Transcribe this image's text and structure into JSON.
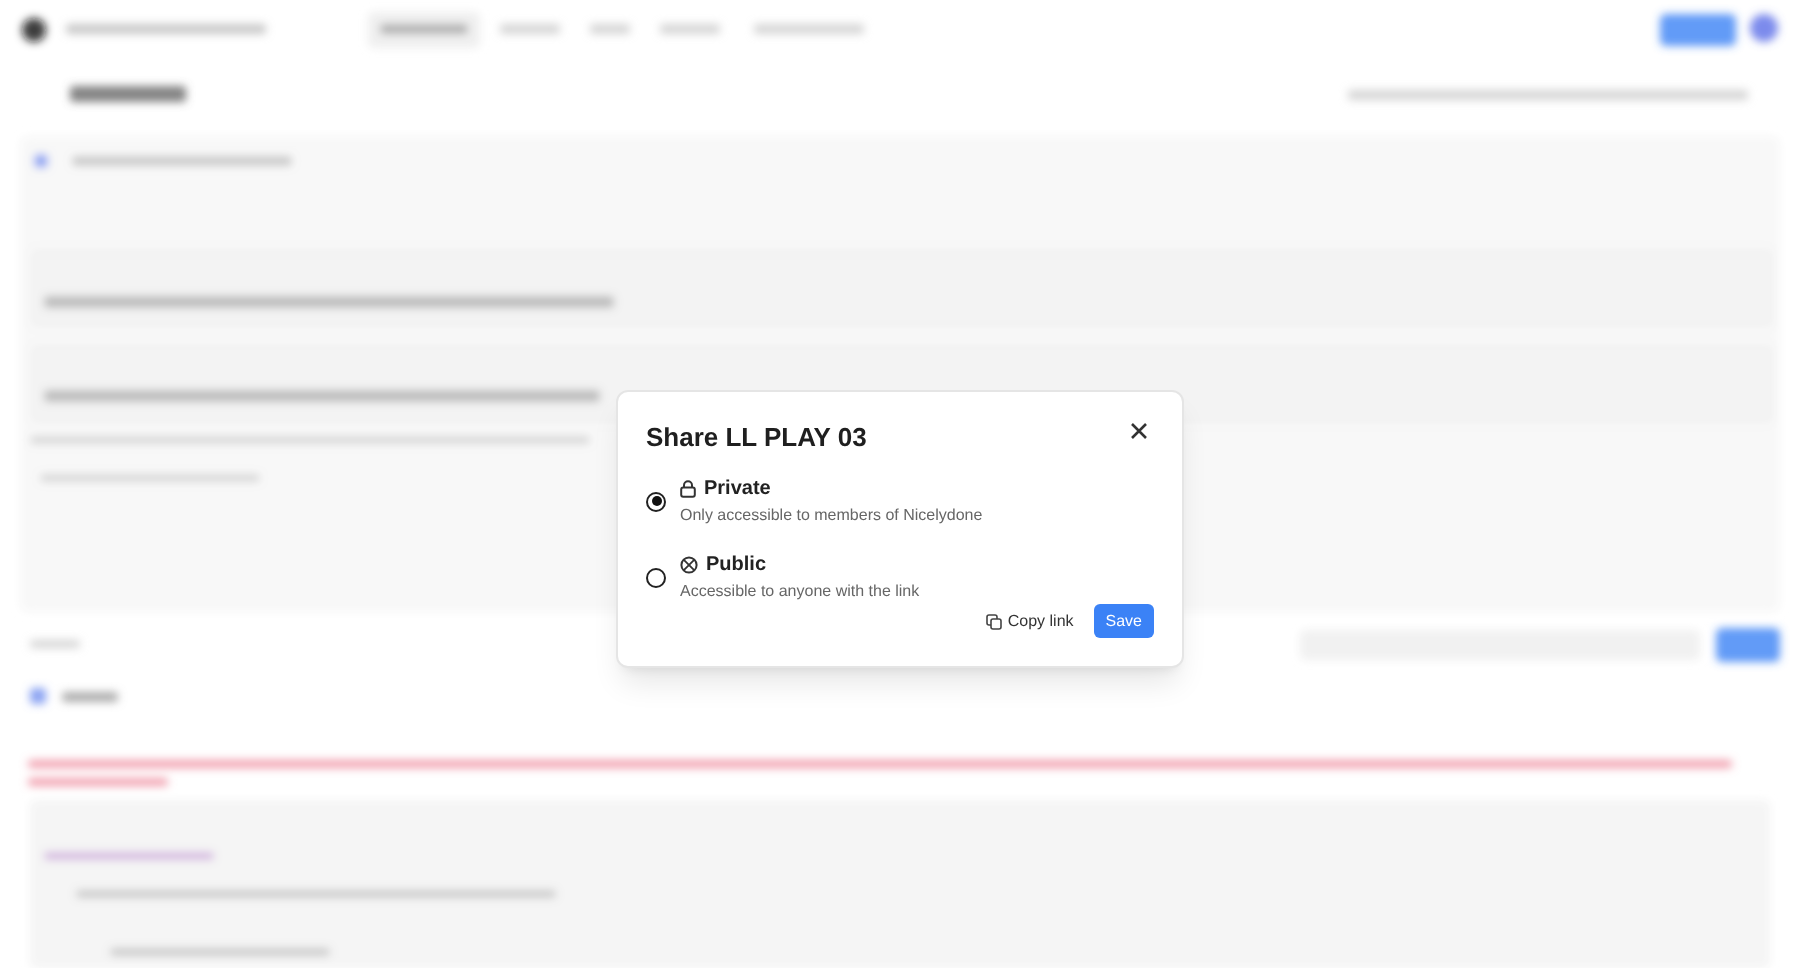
{
  "dialog": {
    "title": "Share LL PLAY 03",
    "options": [
      {
        "kind": "private",
        "label": "Private",
        "description": "Only accessible to members of Nicelydone",
        "selected": true
      },
      {
        "kind": "public",
        "label": "Public",
        "description": "Accessible to anyone with the link",
        "selected": false
      }
    ],
    "buttons": [
      {
        "kind": "secondary",
        "label": "Copy link"
      },
      {
        "kind": "primary",
        "label": "Save"
      }
    ]
  }
}
